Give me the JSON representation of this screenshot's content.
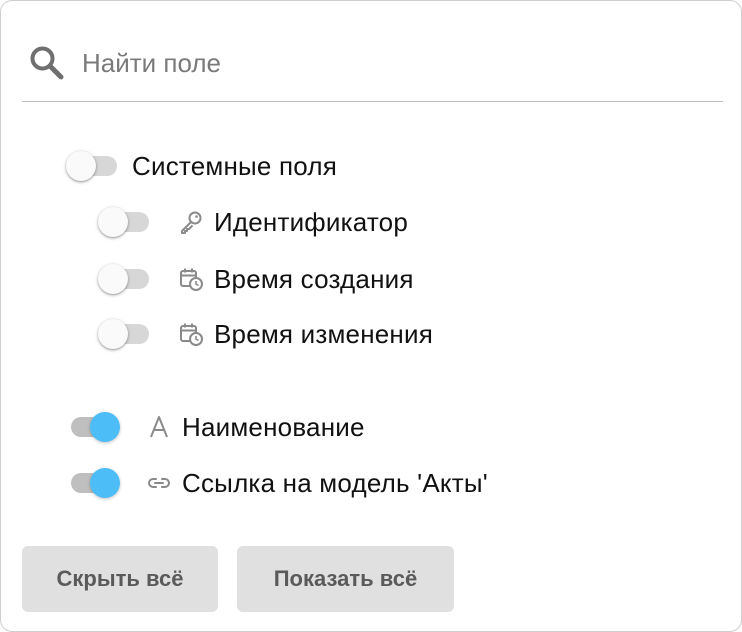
{
  "search": {
    "placeholder": "Найти поле",
    "value": ""
  },
  "system_group": {
    "label": "Системные поля",
    "enabled": false,
    "fields": [
      {
        "label": "Идентификатор",
        "icon": "key-icon",
        "enabled": false
      },
      {
        "label": "Время создания",
        "icon": "calendar-clock-icon",
        "enabled": false
      },
      {
        "label": "Время изменения",
        "icon": "calendar-clock-icon",
        "enabled": false
      }
    ]
  },
  "fields": [
    {
      "label": "Наименование",
      "icon": "text-icon",
      "enabled": true
    },
    {
      "label": "Ссылка на модель 'Акты'",
      "icon": "link-icon",
      "enabled": true
    }
  ],
  "actions": {
    "hide_all": "Скрыть всё",
    "show_all": "Показать всё"
  },
  "colors": {
    "toggle_on": "#4dbdf7",
    "button_bg": "#e0e0e0"
  }
}
